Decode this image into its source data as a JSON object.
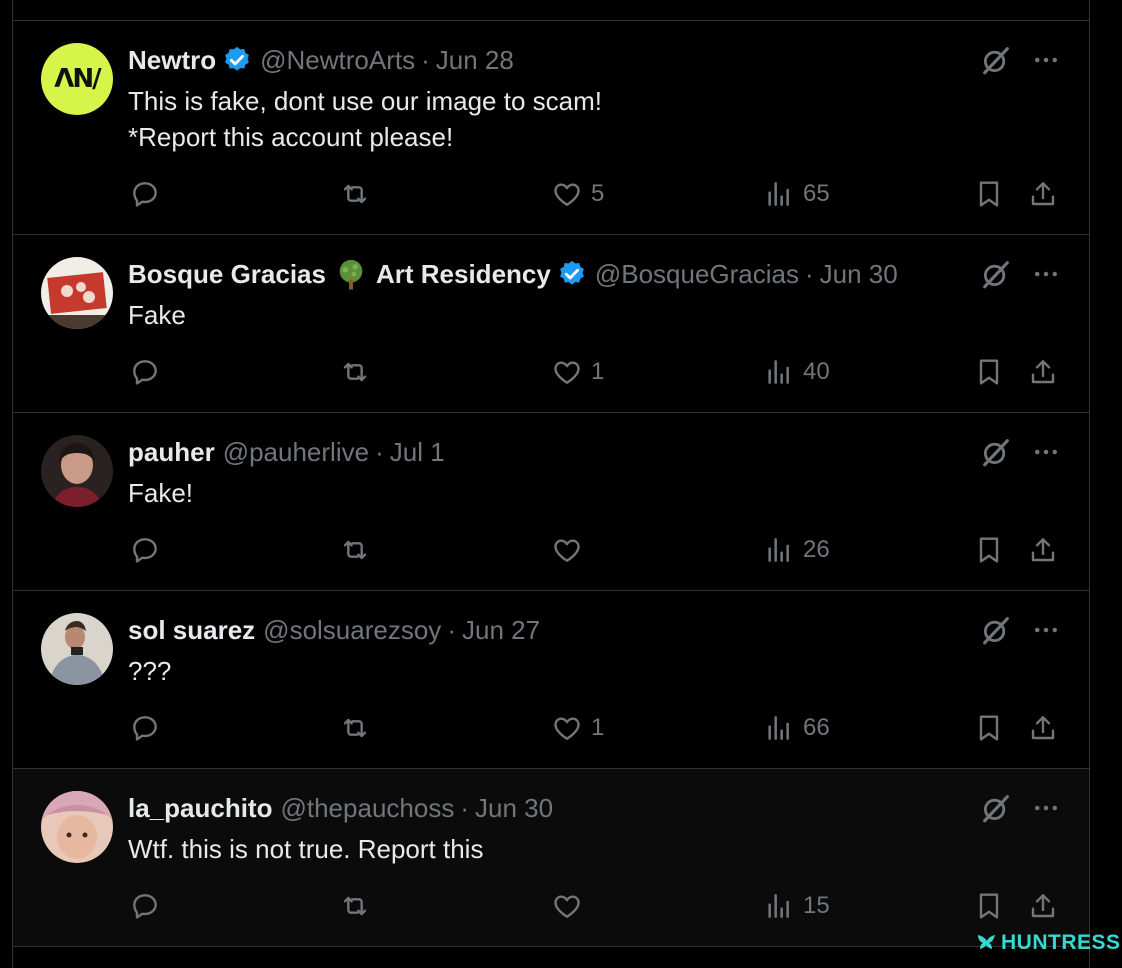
{
  "icons": {
    "reply": "reply-icon",
    "repost": "repost-icon",
    "like": "heart-icon",
    "views": "views-icon",
    "bookmark": "bookmark-icon",
    "share": "share-icon",
    "grok": "grok-icon",
    "more": "more-icon",
    "verified": "verified-badge-icon"
  },
  "colors": {
    "background": "#000000",
    "text_primary": "#e7e9ea",
    "text_secondary": "#71767b",
    "divider": "#2f3336",
    "verified": "#1d9bf0",
    "newtro_brand": "#d6f44a",
    "huntress": "#38d7d0"
  },
  "posts": [
    {
      "name": "Newtro",
      "verified": true,
      "handle": "@NewtroArts",
      "separator": "·",
      "date": "Jun 28",
      "text": "This is fake, dont use our image to scam!\n*Report this account please!",
      "likes": "5",
      "views": "65",
      "avatar_text": "ΛN/"
    },
    {
      "name_part1": "Bosque Gracias",
      "name_emoji": "tree-emoji",
      "name_part2": "Art Residency",
      "verified": true,
      "handle": "@BosqueGracias",
      "separator": "·",
      "date": "Jun 30",
      "text": "Fake",
      "likes": "1",
      "views": "40"
    },
    {
      "name": "pauher",
      "verified": false,
      "handle": "@pauherlive",
      "separator": "·",
      "date": "Jul 1",
      "text": "Fake!",
      "likes": "",
      "views": "26"
    },
    {
      "name": "sol suarez",
      "verified": false,
      "handle": "@solsuarezsoy",
      "separator": "·",
      "date": "Jun 27",
      "text": "???",
      "likes": "1",
      "views": "66"
    },
    {
      "name": "la_pauchito",
      "verified": false,
      "handle": "@thepauchoss",
      "separator": "·",
      "date": "Jun 30",
      "text": "Wtf. this is not true. Report this",
      "likes": "",
      "views": "15"
    }
  ],
  "watermark": "HUNTRESS"
}
